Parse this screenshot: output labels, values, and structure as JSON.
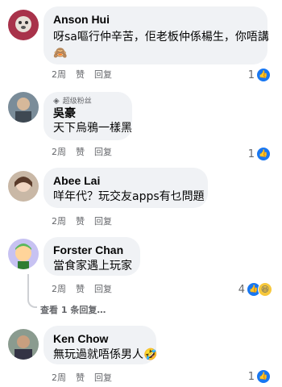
{
  "actions": {
    "time": "2周",
    "like": "赞",
    "reply": "回复"
  },
  "comments": [
    {
      "name": "Anson Hui",
      "text": "呀sa嘔行仲辛苦，佢老板仲係楊生，你唔講",
      "text2": "🙈",
      "reactions": "1"
    },
    {
      "name": "吳豪",
      "badge": "超级粉丝",
      "text": "天下烏鴉一樣黑",
      "reactions": "1"
    },
    {
      "name": "Abee Lai",
      "text": "咩年代？玩交友apps有乜問題",
      "reactions": ""
    },
    {
      "name": "Forster Chan",
      "text": "當食家遇上玩家",
      "reactions": "4"
    },
    {
      "name": "Ken Chow",
      "text": "無玩過就唔係男人🤣",
      "reactions": "1"
    }
  ],
  "view_replies": "查看 1 条回复…",
  "colors": {
    "bubble": "#f0f2f5",
    "like": "#1877f2",
    "secondary_text": "#65676b"
  }
}
